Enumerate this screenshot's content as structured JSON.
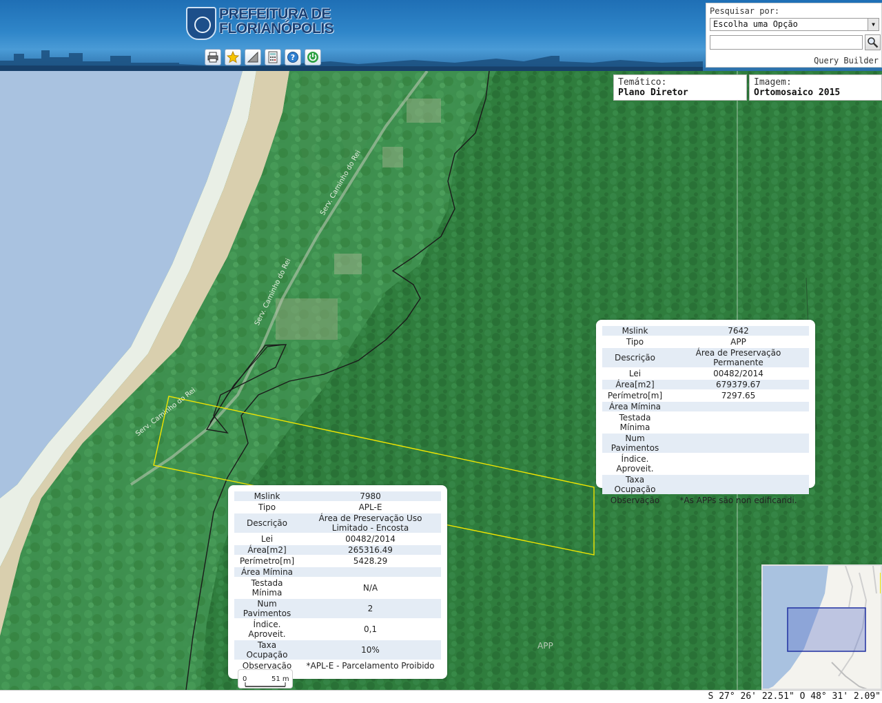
{
  "header": {
    "title_line1": "PREFEITURA DE",
    "title_line2": "FLORIANÓPOLIS",
    "toolbar": [
      "print-icon",
      "star-icon",
      "measure-icon",
      "calculator-icon",
      "help-icon",
      "power-icon"
    ]
  },
  "search": {
    "label": "Pesquisar por:",
    "select_value": "Escolha uma Opção",
    "input_value": "",
    "query_builder": "Query Builder"
  },
  "tematico": {
    "label": "Temático:",
    "value": "Plano Diretor"
  },
  "imagem": {
    "label": "Imagem:",
    "value": "Ortomosaico 2015"
  },
  "popup_app": {
    "rows": [
      {
        "key": "Mslink",
        "value": "7642"
      },
      {
        "key": "Tipo",
        "value": "APP"
      },
      {
        "key": "Descrição",
        "value": "Área de Preservação Permanente"
      },
      {
        "key": "Lei",
        "value": "00482/2014"
      },
      {
        "key": "Área[m2]",
        "value": "679379.67"
      },
      {
        "key": "Perímetro[m]",
        "value": "7297.65"
      },
      {
        "key": "Área Mímina",
        "value": ""
      },
      {
        "key": "Testada Mínima",
        "value": ""
      },
      {
        "key": "Num Pavimentos",
        "value": ""
      },
      {
        "key": "Índice. Aproveit.",
        "value": ""
      },
      {
        "key": "Taxa Ocupação",
        "value": ""
      },
      {
        "key": "Observação",
        "value": "*As APPs são non edificandi."
      }
    ]
  },
  "popup_aple": {
    "rows": [
      {
        "key": "Mslink",
        "value": "7980"
      },
      {
        "key": "Tipo",
        "value": "APL-E"
      },
      {
        "key": "Descrição",
        "value": "Área de Preservação Uso Limitado - Encosta"
      },
      {
        "key": "Lei",
        "value": "00482/2014"
      },
      {
        "key": "Área[m2]",
        "value": "265316.49"
      },
      {
        "key": "Perímetro[m]",
        "value": "5428.29"
      },
      {
        "key": "Área Mímina",
        "value": ""
      },
      {
        "key": "Testada Mínima",
        "value": "N/A"
      },
      {
        "key": "Num Pavimentos",
        "value": "2"
      },
      {
        "key": "Índice. Aproveit.",
        "value": "0,1"
      },
      {
        "key": "Taxa Ocupação",
        "value": "10%"
      },
      {
        "key": "Observação",
        "value": "*APL-E - Parcelamento Proibido"
      }
    ]
  },
  "map_labels": {
    "zone_app": "APP",
    "road_name": "Serv. Caminho do Rei"
  },
  "scalebar": {
    "left": "0",
    "right": "51 m"
  },
  "status": {
    "coordinates": "S 27° 26' 22.51\" O 48° 31' 2.09\""
  },
  "colors": {
    "forest": "#2e7a3c",
    "sea": "#a9c2e0",
    "parcel_outline": "#f2e600",
    "zone_outline": "#1a1a1a"
  }
}
